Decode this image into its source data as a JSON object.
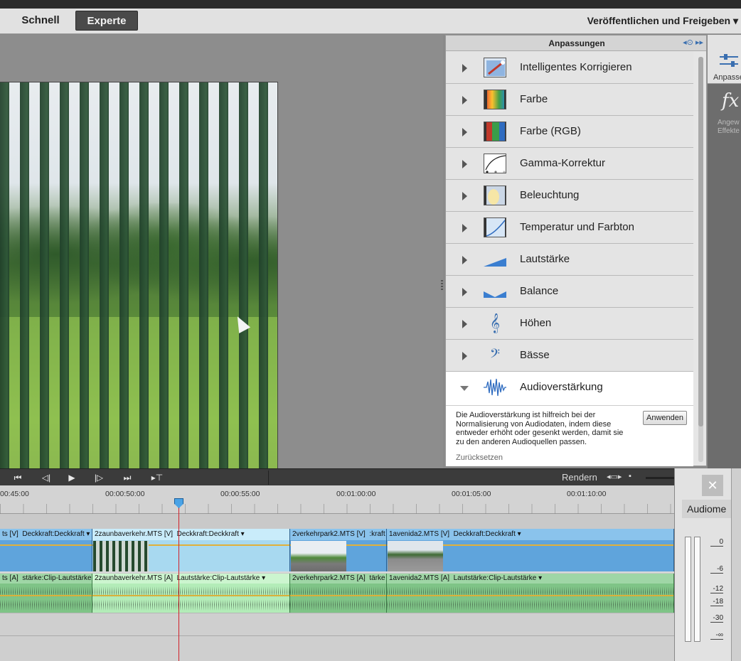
{
  "header": {
    "quick_label": "Schnell",
    "expert_label": "Experte",
    "publish_label": "Veröffentlichen und Freigeben"
  },
  "adjustments": {
    "title": "Anpassungen",
    "items": [
      {
        "label": "Intelligentes Korrigieren",
        "icon": "smart-fix-icon"
      },
      {
        "label": "Farbe",
        "icon": "color-icon"
      },
      {
        "label": "Farbe (RGB)",
        "icon": "color-rgb-icon"
      },
      {
        "label": "Gamma-Korrektur",
        "icon": "gamma-curve-icon"
      },
      {
        "label": "Beleuchtung",
        "icon": "lighting-icon"
      },
      {
        "label": "Temperatur und Farbton",
        "icon": "temperature-icon"
      },
      {
        "label": "Lautstärke",
        "icon": "volume-ramp-icon"
      },
      {
        "label": "Balance",
        "icon": "balance-icon"
      },
      {
        "label": "Höhen",
        "icon": "treble-clef-icon"
      },
      {
        "label": "Bässe",
        "icon": "bass-clef-icon"
      },
      {
        "label": "Audioverstärkung",
        "icon": "audio-gain-waveform-icon"
      }
    ],
    "description": "Die Audioverstärkung ist hilfreich bei der Normalisierung von Audiodaten, indem diese entweder erhöht oder gesenkt werden, damit sie zu den anderen Audioquellen passen.",
    "apply_label": "Anwenden",
    "reset_label": "Zurücksetzen"
  },
  "right_bar": {
    "adjust_label": "Anpasse",
    "fx_label": "fx",
    "fx_sub_line1": "Angew",
    "fx_sub_line2": "Effekte"
  },
  "timeline": {
    "render_label": "Rendern",
    "ruler_labels": [
      "00:45:00",
      "00:00:50:00",
      "00:00:55:00",
      "00:01:00:00",
      "00:01:05:00",
      "00:01:10:00"
    ],
    "video_clips": [
      {
        "name": "ts [V]",
        "effect": "Deckkraft:Deckkraft"
      },
      {
        "name": "2zaunbaverkehr.MTS [V]",
        "effect": "Deckkraft:Deckkraft"
      },
      {
        "name": "2verkehrpark2.MTS [V]",
        "effect": ":kraft"
      },
      {
        "name": "1avenida2.MTS [V]",
        "effect": "Deckkraft:Deckkraft"
      }
    ],
    "audio_clips": [
      {
        "name": "ts [A]",
        "effect": "stärke:Clip-Lautstärke"
      },
      {
        "name": "2zaunbaverkehr.MTS [A]",
        "effect": "Lautstärke:Clip-Lautstärke"
      },
      {
        "name": "2verkehrpark2.MTS [A]",
        "effect": "tärke"
      },
      {
        "name": "1avenida2.MTS [A]",
        "effect": "Lautstärke:Clip-Lautstärke"
      }
    ]
  },
  "audio_meter": {
    "title": "Audiome",
    "scale": [
      "0",
      "-6",
      "-12",
      "-18",
      "-30",
      "-∞"
    ],
    "close_label": "✕"
  }
}
